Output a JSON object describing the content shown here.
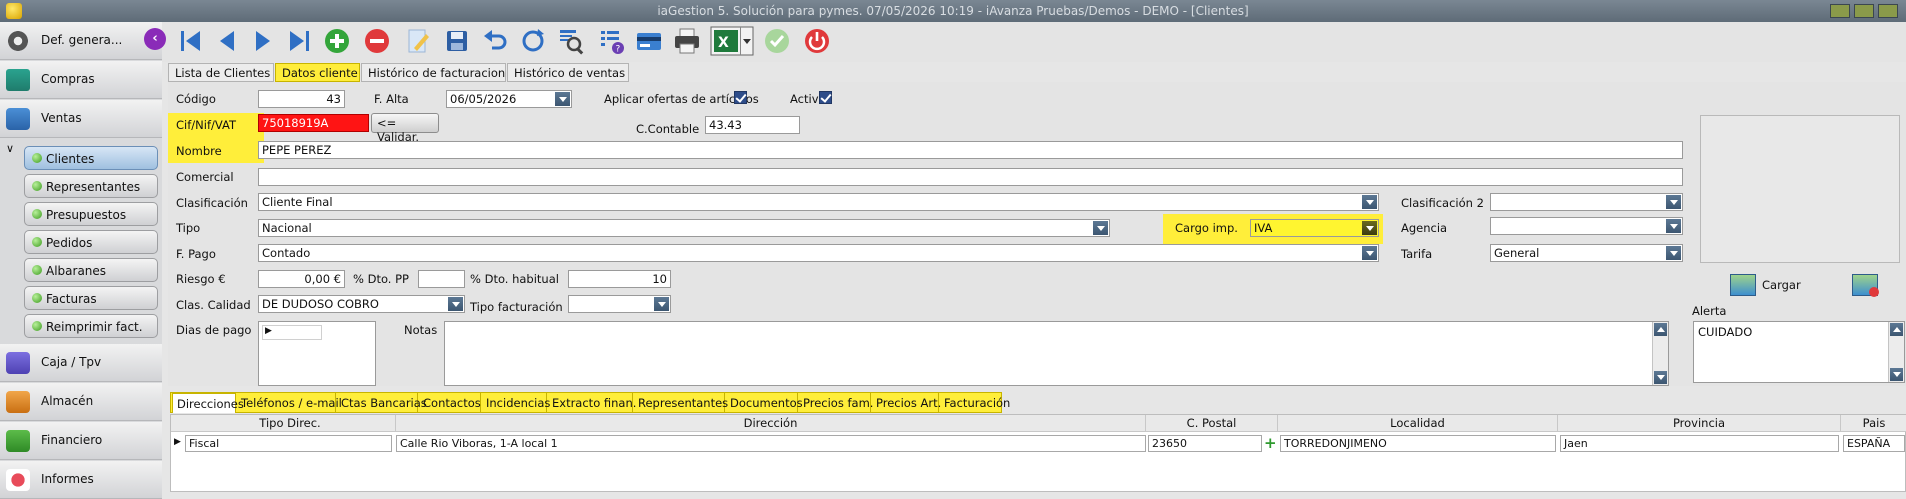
{
  "window": {
    "title": "iaGestion 5. Solución para pymes.   07/05/2026 10:19   -   iAvanza Pruebas/Demos - DEMO - [Clientes]"
  },
  "sidebar": {
    "sections": [
      {
        "label": "Def. genera...",
        "icon": "gear-icon"
      },
      {
        "label": "Compras",
        "icon": "cart-icon"
      },
      {
        "label": "Ventas",
        "icon": "sales-icon"
      }
    ],
    "ventas_items": [
      {
        "label": "Clientes",
        "selected": true
      },
      {
        "label": "Representantes"
      },
      {
        "label": "Presupuestos"
      },
      {
        "label": "Pedidos"
      },
      {
        "label": "Albaranes"
      },
      {
        "label": "Facturas"
      },
      {
        "label": "Reimprimir fact."
      }
    ],
    "bottom_sections": [
      {
        "label": "Caja / Tpv",
        "icon": "register-icon"
      },
      {
        "label": "Almacén",
        "icon": "warehouse-icon"
      },
      {
        "label": "Financiero",
        "icon": "money-icon"
      },
      {
        "label": "Informes",
        "icon": "report-icon"
      }
    ]
  },
  "toolbar": {
    "buttons": [
      "first-icon",
      "prev-icon",
      "next-icon",
      "last-icon",
      "add-icon",
      "delete-icon",
      "edit-icon",
      "save-icon",
      "undo-icon",
      "refresh-icon",
      "search-icon",
      "list-help-icon",
      "card-icon",
      "print-icon",
      "excel-icon",
      "confirm-icon",
      "power-icon"
    ]
  },
  "tabs": {
    "items": [
      "Lista de Clientes",
      "Datos cliente",
      "Histórico de facturacion",
      "Histórico de ventas"
    ],
    "active": 1
  },
  "form": {
    "codigo": {
      "label": "Código",
      "value": "43"
    },
    "f_alta": {
      "label": "F. Alta",
      "value": "06/05/2026"
    },
    "aplicar_ofertas": {
      "label": "Aplicar ofertas de artículos",
      "checked": true
    },
    "activo": {
      "label": "Activo",
      "checked": true
    },
    "cif": {
      "label": "Cif/Nif/VAT",
      "value": "75018919A",
      "validar": "<= Validar."
    },
    "c_contable": {
      "label": "C.Contable",
      "value": "43.43"
    },
    "nombre": {
      "label": "Nombre",
      "value": "PEPE PEREZ"
    },
    "comercial": {
      "label": "Comercial",
      "value": ""
    },
    "clasificacion": {
      "label": "Clasificación",
      "value": "Cliente Final"
    },
    "clasificacion2": {
      "label": "Clasificación 2",
      "value": ""
    },
    "tipo": {
      "label": "Tipo",
      "value": "Nacional"
    },
    "cargo_imp": {
      "label": "Cargo imp.",
      "value": "IVA"
    },
    "agencia": {
      "label": "Agencia",
      "value": ""
    },
    "f_pago": {
      "label": "F. Pago",
      "value": "Contado"
    },
    "tarifa": {
      "label": "Tarifa",
      "value": "General"
    },
    "riesgo": {
      "label": "Riesgo €",
      "value": "0,00 €"
    },
    "dto_pp": {
      "label": "% Dto. PP",
      "value": ""
    },
    "dto_habitual": {
      "label": "% Dto. habitual",
      "value": "10"
    },
    "clas_calidad": {
      "label": "Clas. Calidad",
      "value": "DE DUDOSO COBRO"
    },
    "tipo_facturacion": {
      "label": "Tipo facturación",
      "value": ""
    },
    "dias_pago": {
      "label": "Dias de pago"
    },
    "notas": {
      "label": "Notas",
      "value": ""
    },
    "cargar": {
      "label": "Cargar"
    },
    "alerta": {
      "label": "Alerta",
      "value": "CUIDADO"
    }
  },
  "bottom_tabs": {
    "items": [
      "Direcciones",
      "Teléfonos / e-mail",
      "Ctas Bancarias",
      "Contactos",
      "Incidencias",
      "Extracto finan.",
      "Representantes",
      "Documentos",
      "Precios fam.",
      "Precios Art.",
      "Facturación"
    ],
    "active": 0
  },
  "address_table": {
    "columns": [
      "Tipo Direc.",
      "Dirección",
      "C. Postal",
      "Localidad",
      "Provincia",
      "Pais"
    ],
    "rows": [
      [
        "Fiscal",
        "Calle Rio Viboras, 1-A local 1",
        "23650",
        "TORREDONJIMENO",
        "Jaen",
        "ESPAÑA"
      ]
    ]
  }
}
